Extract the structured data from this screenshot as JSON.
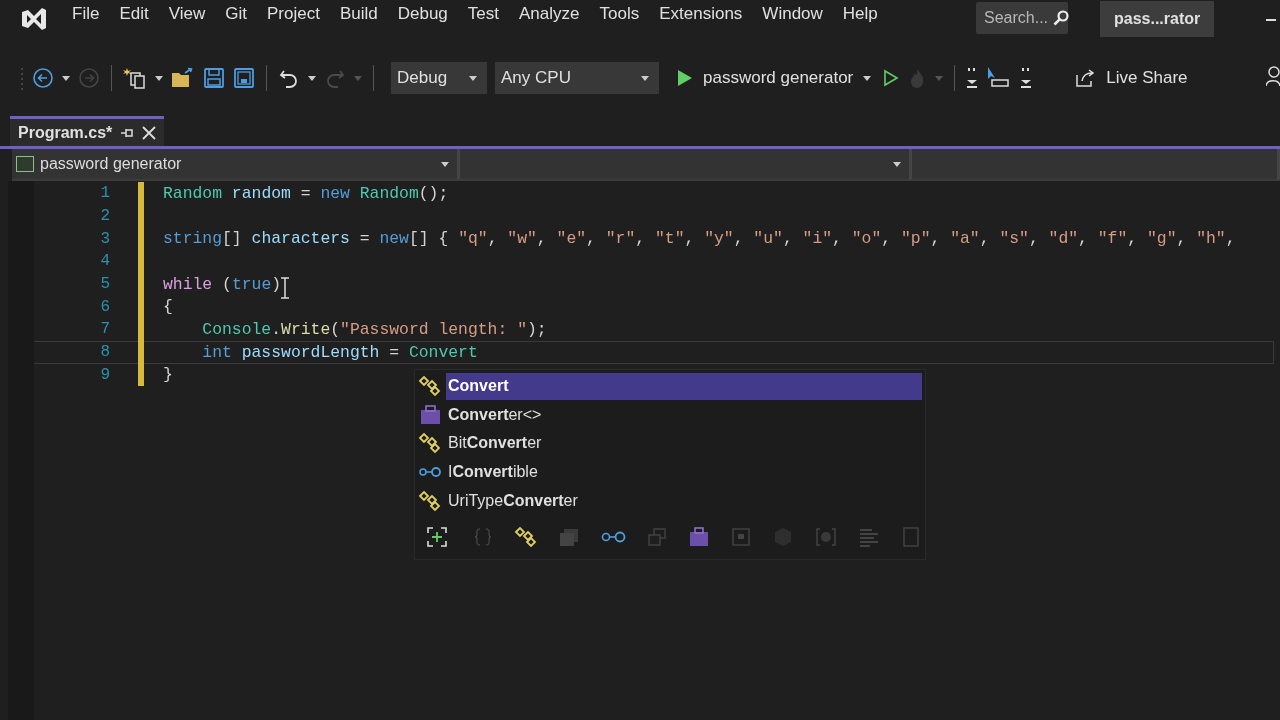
{
  "menu": [
    "File",
    "Edit",
    "View",
    "Git",
    "Project",
    "Build",
    "Debug",
    "Test",
    "Analyze",
    "Tools",
    "Extensions",
    "Window",
    "Help"
  ],
  "search": {
    "placeholder": "Search..."
  },
  "solution_title": "pass...rator",
  "toolbar": {
    "configuration": "Debug",
    "platform": "Any CPU",
    "start_target": "password generator",
    "live_share": "Live Share"
  },
  "tabs": [
    {
      "label": "Program.cs*",
      "selected": true
    }
  ],
  "navigation": {
    "project": "password generator"
  },
  "code_lines": [
    {
      "number": "1",
      "current": false,
      "tokens": [
        {
          "kind": "type",
          "text": "Random"
        },
        {
          "kind": "local",
          "text": " random"
        },
        {
          "kind": "plain",
          "text": " = "
        },
        {
          "kind": "keyword",
          "text": "new"
        },
        {
          "kind": "type",
          "text": " Random"
        },
        {
          "kind": "plain",
          "text": "();"
        }
      ]
    },
    {
      "number": "2",
      "current": false
    },
    {
      "number": "3",
      "current": false,
      "tokens": [
        {
          "kind": "keyword",
          "text": "string"
        },
        {
          "kind": "plain",
          "text": "[] "
        },
        {
          "kind": "local",
          "text": "characters"
        },
        {
          "kind": "plain",
          "text": " = "
        },
        {
          "kind": "keyword",
          "text": "new"
        },
        {
          "kind": "plain",
          "text": "[] { "
        },
        {
          "kind": "string",
          "text": "\"q\""
        },
        {
          "kind": "plain",
          "text": ", "
        },
        {
          "kind": "string",
          "text": "\"w\""
        },
        {
          "kind": "plain",
          "text": ", "
        },
        {
          "kind": "string",
          "text": "\"e\""
        },
        {
          "kind": "plain",
          "text": ", "
        },
        {
          "kind": "string",
          "text": "\"r\""
        },
        {
          "kind": "plain",
          "text": ", "
        },
        {
          "kind": "string",
          "text": "\"t\""
        },
        {
          "kind": "plain",
          "text": ", "
        },
        {
          "kind": "string",
          "text": "\"y\""
        },
        {
          "kind": "plain",
          "text": ", "
        },
        {
          "kind": "string",
          "text": "\"u\""
        },
        {
          "kind": "plain",
          "text": ", "
        },
        {
          "kind": "string",
          "text": "\"i\""
        },
        {
          "kind": "plain",
          "text": ", "
        },
        {
          "kind": "string",
          "text": "\"o\""
        },
        {
          "kind": "plain",
          "text": ", "
        },
        {
          "kind": "string",
          "text": "\"p\""
        },
        {
          "kind": "plain",
          "text": ", "
        },
        {
          "kind": "string",
          "text": "\"a\""
        },
        {
          "kind": "plain",
          "text": ", "
        },
        {
          "kind": "string",
          "text": "\"s\""
        },
        {
          "kind": "plain",
          "text": ", "
        },
        {
          "kind": "string",
          "text": "\"d\""
        },
        {
          "kind": "plain",
          "text": ", "
        },
        {
          "kind": "string",
          "text": "\"f\""
        },
        {
          "kind": "plain",
          "text": ", "
        },
        {
          "kind": "string",
          "text": "\"g\""
        },
        {
          "kind": "plain",
          "text": ", "
        },
        {
          "kind": "string",
          "text": "\"h\""
        },
        {
          "kind": "plain",
          "text": ","
        }
      ]
    },
    {
      "number": "4",
      "current": false
    },
    {
      "number": "5",
      "current": false,
      "tokens": [
        {
          "kind": "control",
          "text": "while"
        },
        {
          "kind": "plain",
          "text": " ("
        },
        {
          "kind": "keyword",
          "text": "true"
        },
        {
          "kind": "plain",
          "text": ")"
        }
      ]
    },
    {
      "number": "6",
      "current": false,
      "tokens": [
        {
          "kind": "plain",
          "text": "{"
        }
      ]
    },
    {
      "number": "7",
      "current": false,
      "tokens": [
        {
          "kind": "type",
          "text": "    Console"
        },
        {
          "kind": "plain",
          "text": "."
        },
        {
          "kind": "method",
          "text": "Write"
        },
        {
          "kind": "plain",
          "text": "("
        },
        {
          "kind": "string",
          "text": "\"Password length: \""
        },
        {
          "kind": "plain",
          "text": ");"
        }
      ]
    },
    {
      "number": "8",
      "current": true,
      "tokens": [
        {
          "kind": "keyword",
          "text": "    int"
        },
        {
          "kind": "local",
          "text": " passwordLength"
        },
        {
          "kind": "plain",
          "text": " = "
        },
        {
          "kind": "type",
          "text": "Convert"
        }
      ]
    },
    {
      "number": "9",
      "current": false,
      "tokens": [
        {
          "kind": "plain",
          "text": "}"
        }
      ]
    }
  ],
  "completion": {
    "items": [
      {
        "kind": "class",
        "match": "Convert",
        "selected": true
      },
      {
        "kind": "generic",
        "match": "Convert",
        "suffix": "er<>",
        "selected": false
      },
      {
        "kind": "class",
        "prefix": "Bit",
        "match": "Convert",
        "suffix": "er",
        "selected": false
      },
      {
        "kind": "interface",
        "prefix": "I",
        "match": "Convert",
        "suffix": "ible",
        "selected": false
      },
      {
        "kind": "class",
        "prefix": "UriType",
        "match": "Convert",
        "suffix": "er",
        "selected": false
      }
    ]
  }
}
